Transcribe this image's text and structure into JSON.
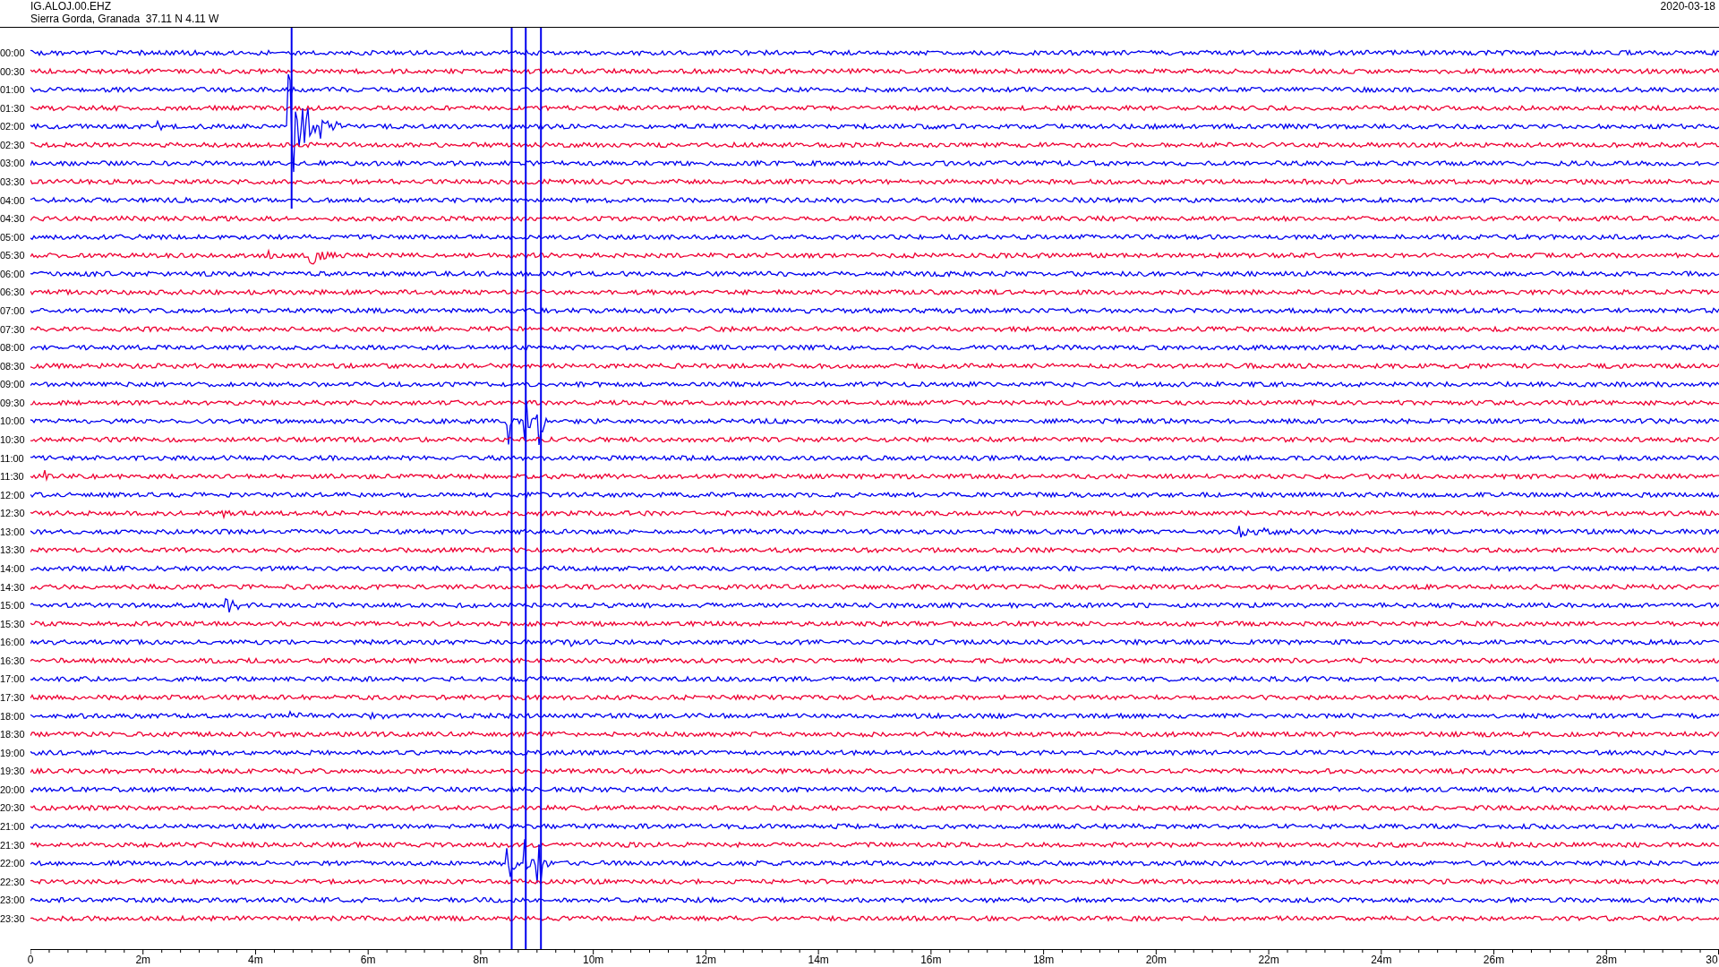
{
  "header": {
    "station": "IG.ALOJ.00.EHZ",
    "location": "Sierra Gorda, Granada  37.11 N 4.11 W",
    "date": "2020-03-18"
  },
  "rows": [
    {
      "time": "00:00"
    },
    {
      "time": "00:30"
    },
    {
      "time": "01:00"
    },
    {
      "time": "01:30"
    },
    {
      "time": "02:00"
    },
    {
      "time": "02:30"
    },
    {
      "time": "03:00"
    },
    {
      "time": "03:30"
    },
    {
      "time": "04:00"
    },
    {
      "time": "04:30"
    },
    {
      "time": "05:00"
    },
    {
      "time": "05:30"
    },
    {
      "time": "06:00"
    },
    {
      "time": "06:30"
    },
    {
      "time": "07:00"
    },
    {
      "time": "07:30"
    },
    {
      "time": "08:00"
    },
    {
      "time": "08:30"
    },
    {
      "time": "09:00"
    },
    {
      "time": "09:30"
    },
    {
      "time": "10:00"
    },
    {
      "time": "10:30"
    },
    {
      "time": "11:00"
    },
    {
      "time": "11:30"
    },
    {
      "time": "12:00"
    },
    {
      "time": "12:30"
    },
    {
      "time": "13:00"
    },
    {
      "time": "13:30"
    },
    {
      "time": "14:00"
    },
    {
      "time": "14:30"
    },
    {
      "time": "15:00"
    },
    {
      "time": "15:30"
    },
    {
      "time": "16:00"
    },
    {
      "time": "16:30"
    },
    {
      "time": "17:00"
    },
    {
      "time": "17:30"
    },
    {
      "time": "18:00"
    },
    {
      "time": "18:30"
    },
    {
      "time": "19:00"
    },
    {
      "time": "19:30"
    },
    {
      "time": "20:00"
    },
    {
      "time": "20:30"
    },
    {
      "time": "21:00"
    },
    {
      "time": "21:30"
    },
    {
      "time": "22:00"
    },
    {
      "time": "22:30"
    },
    {
      "time": "23:00"
    },
    {
      "time": "23:30"
    }
  ],
  "x_axis": {
    "tick_labels": [
      "0",
      "2m",
      "4m",
      "6m",
      "8m",
      "10m",
      "12m",
      "14m",
      "16m",
      "18m",
      "20m",
      "22m",
      "24m",
      "26m",
      "28m",
      "30"
    ]
  }
}
